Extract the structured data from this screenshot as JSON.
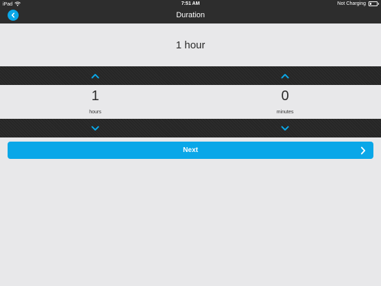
{
  "status_bar": {
    "device": "iPad",
    "time": "7:51 AM",
    "charging": "Not Charging",
    "icons": [
      "wifi-icon",
      "battery-icon"
    ]
  },
  "nav": {
    "title": "Duration",
    "back_icon": "chevron-left-icon"
  },
  "summary": {
    "text": "1 hour"
  },
  "picker": {
    "hours": {
      "value": "1",
      "unit": "hours"
    },
    "minutes": {
      "value": "0",
      "unit": "minutes"
    },
    "up_icon": "chevron-up-icon",
    "down_icon": "chevron-down-icon"
  },
  "next_button": {
    "label": "Next",
    "icon": "chevron-right-icon"
  },
  "colors": {
    "accent": "#0aa7e8",
    "bar": "#2d2d2d",
    "band": "#262626",
    "background": "#e8e8ea"
  }
}
